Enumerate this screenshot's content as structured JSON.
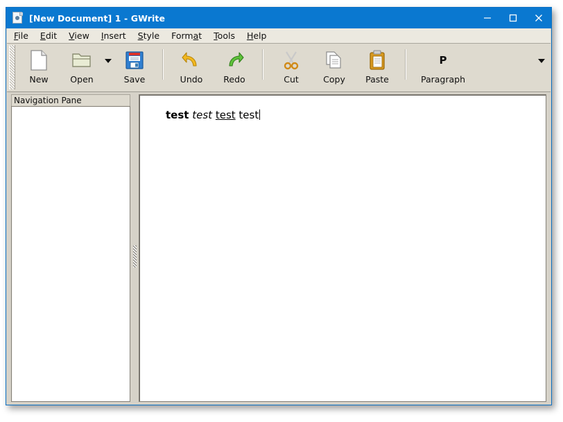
{
  "window": {
    "title": "[New Document] 1 - GWrite",
    "icon": "document-icon",
    "accent_color": "#0a78d0",
    "controls": {
      "minimize": "minimize-icon",
      "maximize": "maximize-icon",
      "close": "close-icon"
    }
  },
  "menubar": {
    "items": [
      {
        "label": "File",
        "mnemonic": "F"
      },
      {
        "label": "Edit",
        "mnemonic": "E"
      },
      {
        "label": "View",
        "mnemonic": "V"
      },
      {
        "label": "Insert",
        "mnemonic": "I"
      },
      {
        "label": "Style",
        "mnemonic": "S"
      },
      {
        "label": "Format",
        "mnemonic": "a"
      },
      {
        "label": "Tools",
        "mnemonic": "T"
      },
      {
        "label": "Help",
        "mnemonic": "H"
      }
    ]
  },
  "toolbar": {
    "buttons": [
      {
        "label": "New",
        "icon": "new-document-icon"
      },
      {
        "label": "Open",
        "icon": "open-folder-icon",
        "has_dropdown": true
      },
      {
        "label": "Save",
        "icon": "save-floppy-icon"
      },
      {
        "label": "Undo",
        "icon": "undo-arrow-icon"
      },
      {
        "label": "Redo",
        "icon": "redo-arrow-icon"
      },
      {
        "label": "Cut",
        "icon": "scissors-icon"
      },
      {
        "label": "Copy",
        "icon": "copy-pages-icon"
      },
      {
        "label": "Paste",
        "icon": "paste-clipboard-icon"
      },
      {
        "label": "Paragraph",
        "icon": "paragraph-p-icon",
        "glyph": "P",
        "has_dropdown": true
      }
    ]
  },
  "navigation_pane": {
    "title": "Navigation Pane",
    "items": []
  },
  "editor": {
    "line": {
      "bold_text": "test",
      "italic_text": "test",
      "underline_text": "test",
      "plain_text": "test"
    }
  }
}
